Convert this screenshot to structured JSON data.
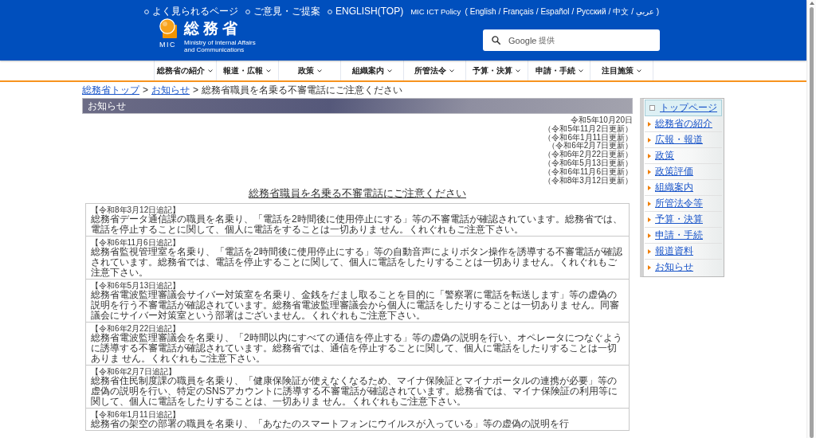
{
  "header": {
    "logo": {
      "name": "総務省",
      "abbr": "MIC",
      "english_name": [
        "Ministry of Internal Affairs",
        "and Communications"
      ]
    },
    "links": [
      {
        "label": "よく見られるページ"
      },
      {
        "label": "ご意見・ご提案"
      },
      {
        "label": "ENGLISH(TOP)"
      }
    ],
    "policy_links": [
      {
        "kind": "label",
        "text": "MIC ICT Policy"
      },
      {
        "kind": "punct",
        "text": "("
      },
      {
        "kind": "link",
        "text": "English"
      },
      {
        "kind": "punct",
        "text": "/"
      },
      {
        "kind": "link",
        "text": "Français"
      },
      {
        "kind": "punct",
        "text": "/"
      },
      {
        "kind": "link",
        "text": "Español"
      },
      {
        "kind": "punct",
        "text": "/"
      },
      {
        "kind": "link",
        "text": "Русский"
      },
      {
        "kind": "punct",
        "text": "/"
      },
      {
        "kind": "link",
        "text": "中文"
      },
      {
        "kind": "punct",
        "text": "/"
      },
      {
        "kind": "link",
        "text": "عربي"
      },
      {
        "kind": "punct",
        "text": ")"
      }
    ],
    "search": {
      "brand": "Google",
      "brand_note": "提供"
    }
  },
  "nav": [
    {
      "label": "総務省の紹介"
    },
    {
      "label": "報道・広報"
    },
    {
      "label": "政策"
    },
    {
      "label": "組織案内"
    },
    {
      "label": "所管法令"
    },
    {
      "label": "予算・決算"
    },
    {
      "label": "申請・手続"
    },
    {
      "label": "注目施策"
    }
  ],
  "breadcrumb": [
    {
      "kind": "link",
      "text": "総務省トップ"
    },
    {
      "kind": "separator",
      "text": ">"
    },
    {
      "kind": "link",
      "text": "お知らせ"
    },
    {
      "kind": "separator",
      "text": ">"
    },
    {
      "kind": "current",
      "text": "総務省職員を名乗る不審電話にご注意ください"
    }
  ],
  "section_title": "お知らせ",
  "dates": [
    "令和5年10月20日",
    "（令和5年11月2日更新）",
    "（令和6年1月11日更新）",
    "（令和6年2月7日更新）",
    "（令和6年2月22日更新）",
    "（令和6年5月13日更新）",
    "（令和6年11月6日更新）",
    "（令和8年3月12日更新）"
  ],
  "notice_title": "総務省職員を名乗る不審電話にご注意ください",
  "notices": [
    {
      "heading": "【令和8年3月12日追記】",
      "body": "総務省データ通信課の職員を名乗り、「電話を2時間後に使用停止にする」等の不審電話が確認されています。総務省では、電話を停止することに関して、個人に電話をすることは一切ありま せん。くれぐれもご注意下さい。"
    },
    {
      "heading": "【令和6年11月6日追記】",
      "body": "総務省監視管理室を名乗り、「電話を2時間後に使用停止にする」等の自動音声によりボタン操作を誘導する不審電話が確認されています。総務省では、電話を停止することに関して、個人に電話をしたりすることは一切ありません。くれぐれもご注意下さい。"
    },
    {
      "heading": "【令和6年5月13日追記】",
      "body": "総務省電波監理審議会サイバー対策室を名乗り、金銭をだまし取ることを目的に「警察署に電話を転送します」等の虚偽の説明を行う不審電話が確認されています。総務省電波監理審議会から個人に電話をしたりすることは一切ありま せん。同審議会にサイバー対策室という部署はございません。くれぐれもご注意下さい。"
    },
    {
      "heading": "【令和6年2月22日追記】",
      "body": "総務省電波監理審議会を名乗り、「2時間以内にすべての通信を停止する」等の虚偽の説明を行い、オペレータにつなぐように誘導する不審電話が確認されています。総務省では、通信を停止することに関して、個人に電話をしたりすることは一切ありま せん。くれぐれもご注意下さい。"
    },
    {
      "heading": "【令和6年2月7日追記】",
      "body": "総務省住民制度課の職員を名乗り、「健康保険証が使えなくなるため、マイナ保険証とマイナポータルの連携が必要」等の虚偽の説明を行い、特定のSNSアカウントに誘導する不審電話が確認されています。総務省では、マイナ保険証の利用等に関して、個人に電話をしたりすることは、一切ありま せん。くれぐれもご注意下さい。"
    },
    {
      "heading": "【令和6年1月11日追記】",
      "body": "総務省の架空の部署の職員を名乗り、「あなたのスマートフォンにウイルスが入っている」等の虚偽の説明を行"
    }
  ],
  "sidebar": {
    "items": [
      {
        "kind": "home",
        "label": "トップページ"
      },
      {
        "kind": "link",
        "label": "総務省の紹介"
      },
      {
        "kind": "link",
        "label": "広報・報道"
      },
      {
        "kind": "link",
        "label": "政策"
      },
      {
        "kind": "link",
        "label": "政策評価"
      },
      {
        "kind": "link",
        "label": "組織案内"
      },
      {
        "kind": "link",
        "label": "所管法令等"
      },
      {
        "kind": "link",
        "label": "予算・決算"
      },
      {
        "kind": "link",
        "label": "申請・手続"
      },
      {
        "kind": "link",
        "label": "報道資料"
      },
      {
        "kind": "link",
        "label": "お知らせ"
      }
    ]
  }
}
